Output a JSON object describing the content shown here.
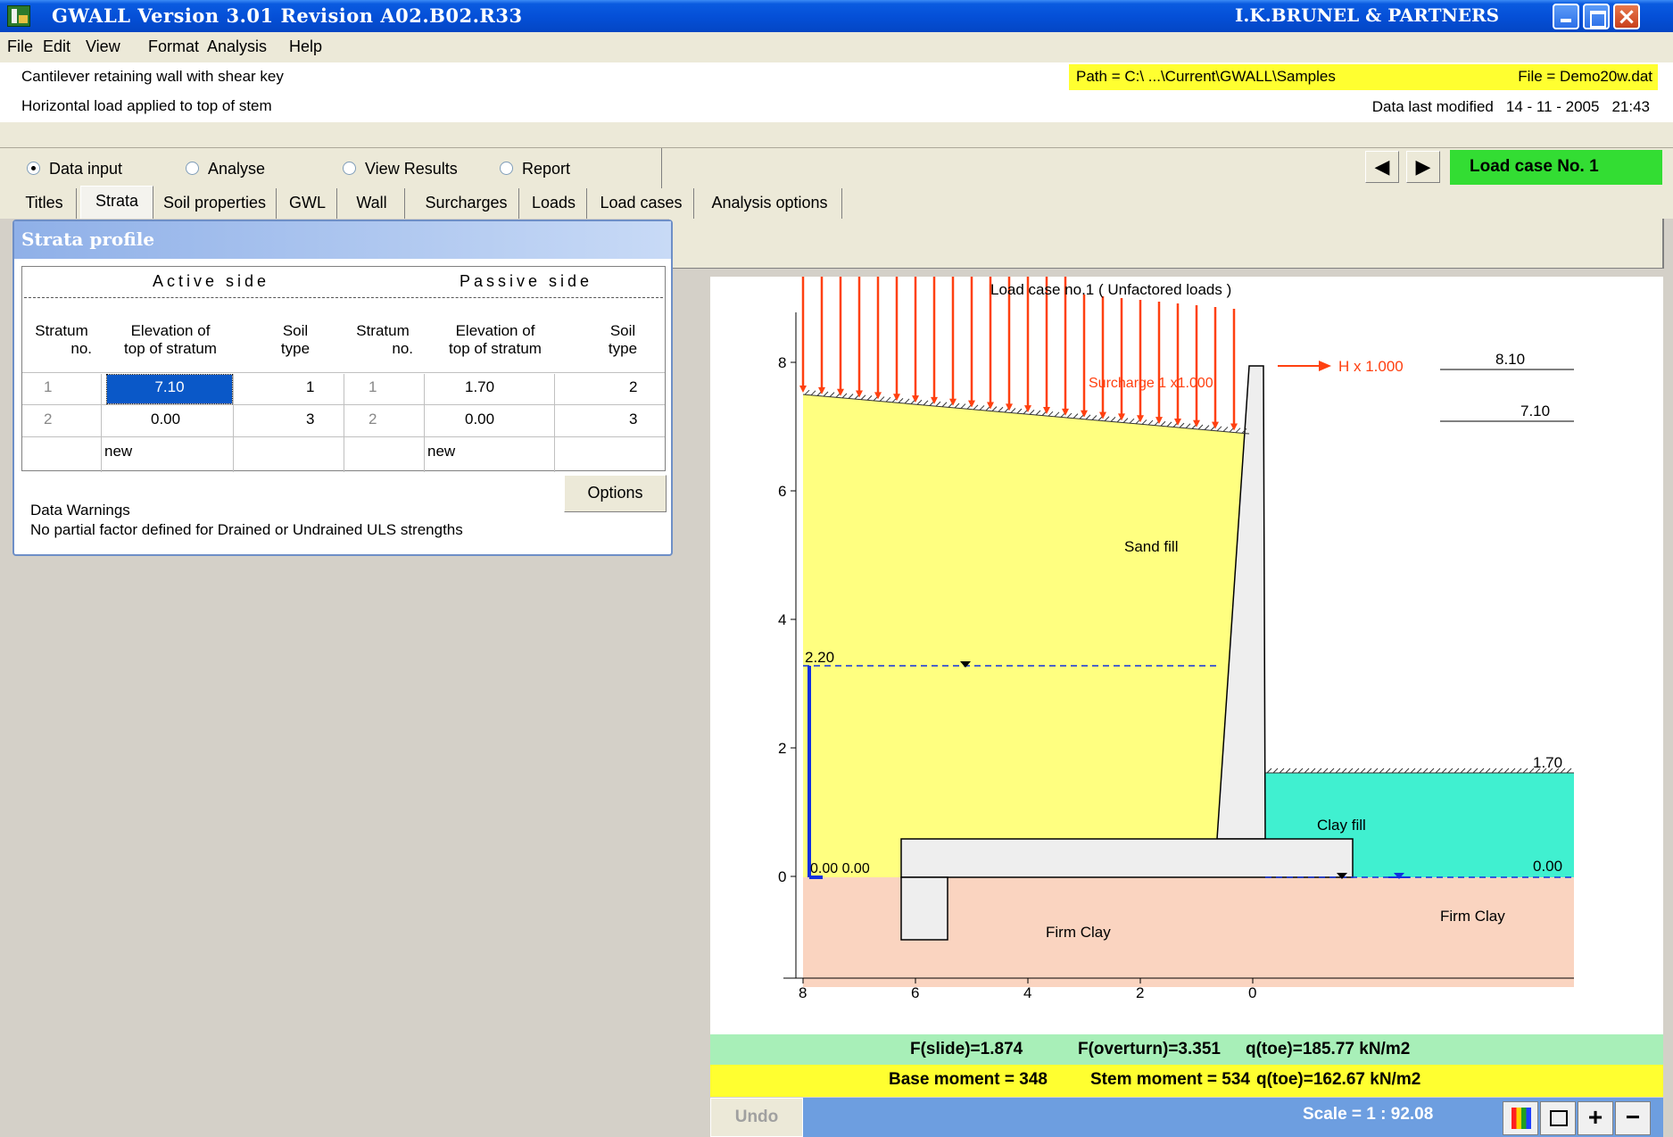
{
  "window": {
    "title": "GWALL   Version 3.01  Revision A02.B02.R33",
    "company": "I.K.BRUNEL & PARTNERS"
  },
  "menu": [
    "File",
    "Edit",
    "View",
    "Format",
    "Analysis",
    "Help"
  ],
  "titles": {
    "line1": "Cantilever retaining wall with shear key",
    "line2": "Horizontal load applied to top of stem",
    "path": "Path = C:\\ ...\\Current\\GWALL\\Samples",
    "file": "File = Demo20w.dat",
    "modified_label": "Data last modified",
    "modified_date": "14 - 11 - 2005",
    "modified_time": "21:43"
  },
  "modes": {
    "items": [
      "Data input",
      "Analyse",
      "View Results",
      "Report"
    ],
    "selected": "Data input"
  },
  "load_case_label": "Load case No. 1",
  "tabs": [
    "Titles",
    "Strata",
    "Soil properties",
    "GWL",
    "Wall",
    "Surcharges",
    "Loads",
    "Load cases",
    "Analysis options"
  ],
  "active_tab": "Strata",
  "strata_panel": {
    "title": "Strata  profile",
    "active_side": "Active  side",
    "passive_side": "Passive  side",
    "headers": {
      "stratum": "Stratum",
      "no": "no.",
      "elevation": "Elevation of",
      "top": "top of stratum",
      "soil": "Soil",
      "type": "type"
    },
    "active_rows": [
      {
        "no": "1",
        "elev": "7.10",
        "type": "1"
      },
      {
        "no": "2",
        "elev": "0.00",
        "type": "3"
      }
    ],
    "passive_rows": [
      {
        "no": "1",
        "elev": "1.70",
        "type": "2"
      },
      {
        "no": "2",
        "elev": "0.00",
        "type": "3"
      }
    ],
    "new_label": "new",
    "options_button": "Options",
    "warnings_title": "Data Warnings",
    "warnings_text": "No partial factor defined for Drained or Undrained ULS strengths"
  },
  "drawing": {
    "title": "Load case no.1   ( Unfactored loads )",
    "surcharge_label": "Surcharge 1  x1.000",
    "h_label": "H x 1.000",
    "level_810": "8.10",
    "level_710": "7.10",
    "level_170": "1.70",
    "level_000": "0.00",
    "gwl_220": "2.20",
    "gwl_base": "0.00 0.00",
    "sand_fill": "Sand fill",
    "clay_fill": "Clay fill",
    "firm_clay_left": "Firm Clay",
    "firm_clay_right": "Firm Clay",
    "y_ticks": [
      "8",
      "6",
      "4",
      "2",
      "0"
    ],
    "x_ticks": [
      "8",
      "6",
      "4",
      "2",
      "0"
    ],
    "colors": {
      "sand": "#ffff80",
      "clay_fill": "#40f0d0",
      "firm_clay": "#fad4c0",
      "wall": "#eeeeee",
      "load": "#ff4010",
      "gwl": "#1030e0"
    }
  },
  "results": {
    "f_slide": "F(slide)=1.874",
    "f_overturn": "F(overturn)=3.351",
    "q_toe1": "q(toe)=185.77 kN/m2",
    "base_moment": "Base moment = 348",
    "stem_moment": "Stem moment = 534",
    "q_toe2": "q(toe)=162.67 kN/m2"
  },
  "bottom": {
    "undo": "Undo",
    "scale": "Scale = 1 : 92.08",
    "plus": "+",
    "minus": "−"
  }
}
